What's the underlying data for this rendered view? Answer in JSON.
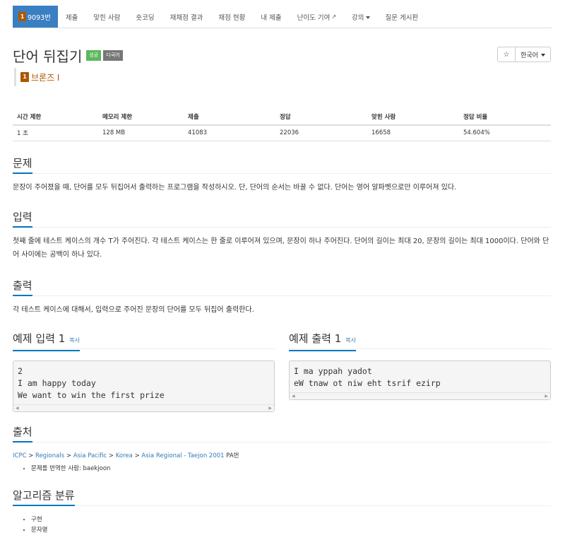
{
  "nav": {
    "items": [
      {
        "label": "9093번",
        "tier": "1",
        "active": true
      },
      {
        "label": "제출"
      },
      {
        "label": "맞힌 사람"
      },
      {
        "label": "숏코딩"
      },
      {
        "label": "재채점 결과"
      },
      {
        "label": "채점 현황"
      },
      {
        "label": "내 제출"
      },
      {
        "label": "난이도 기여",
        "icon": "external-link-icon"
      },
      {
        "label": "강의",
        "icon": "caret-down-icon"
      },
      {
        "label": "질문 게시판"
      }
    ]
  },
  "problem": {
    "title": "단어 뒤집기",
    "labels": [
      "성공",
      "다국어"
    ],
    "tier_badge": "1",
    "tier_text": "브론즈 I"
  },
  "controls": {
    "star": "☆",
    "language": "한국어"
  },
  "info": {
    "headers": [
      "시간 제한",
      "메모리 제한",
      "제출",
      "정답",
      "맞힌 사람",
      "정답 비율"
    ],
    "values": [
      "1 초",
      "128 MB",
      "41083",
      "22036",
      "16658",
      "54.604%"
    ]
  },
  "sections": {
    "problem_heading": "문제",
    "problem_text": "문장이 주어졌을 때, 단어를 모두 뒤집어서 출력하는 프로그램을 작성하시오. 단, 단어의 순서는 바꿀 수 없다. 단어는 영어 알파벳으로만 이루어져 있다.",
    "input_heading": "입력",
    "input_text": "첫째 줄에 테스트 케이스의 개수 T가 주어진다. 각 테스트 케이스는 한 줄로 이루어져 있으며, 문장이 하나 주어진다. 단어의 길이는 최대 20, 문장의 길이는 최대 1000이다. 단어와 단어 사이에는 공백이 하나 있다.",
    "output_heading": "출력",
    "output_text": "각 테스트 케이스에 대해서, 입력으로 주어진 문장의 단어를 모두 뒤집어 출력한다."
  },
  "examples": {
    "input_heading": "예제 입력 1",
    "output_heading": "예제 출력 1",
    "copy_label": "복사",
    "input_text": "2\nI am happy today\nWe want to win the first prize",
    "output_text": "I ma yppah yadot\neW tnaw ot niw eht tsrif ezirp"
  },
  "source": {
    "heading": "출처",
    "breadcrumb": [
      "ICPC",
      "Regionals",
      "Asia Pacific",
      "Korea",
      "Asia Regional - Taejon 2001"
    ],
    "separator": ">",
    "suffix": "PA번",
    "translator": "문제를 번역한 사람: baekjoon"
  },
  "algorithm": {
    "heading": "알고리즘 분류",
    "tags": [
      "구현",
      "문자열"
    ]
  },
  "colors": {
    "nav_active": "#3a7fc1",
    "tier_bronze": "#ad5600",
    "label_success": "#5cb85c",
    "label_default": "#777777",
    "link": "#337ab7",
    "section_underline": "#0076c0"
  }
}
